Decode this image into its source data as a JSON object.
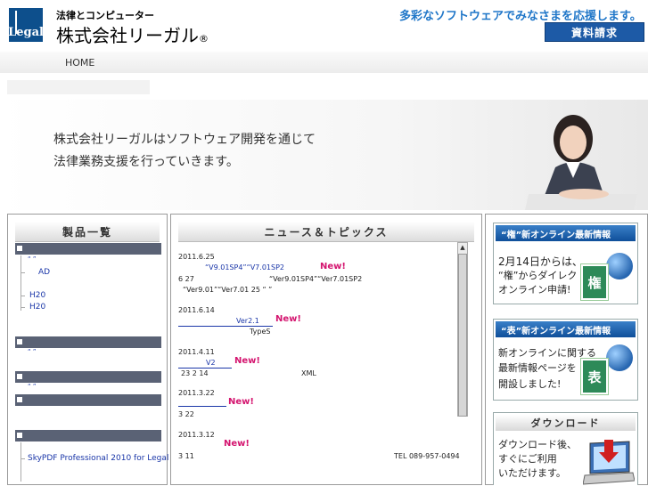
{
  "header": {
    "logo_text": "Legal",
    "tagline": "法律とコンピューター",
    "company": "株式会社リーガル",
    "company_mark": "®",
    "slogan": "多彩なソフトウェアでみなさまを応援します。",
    "request_button": "資料請求"
  },
  "nav": {
    "home": "HOME"
  },
  "hero": {
    "line1": "株式会社リーガルはソフトウェア開発を通じて",
    "line2": "法律業務支援を行っていきます。"
  },
  "products": {
    "heading": "製品一覧",
    "items": [
      "“ ”",
      "AD",
      "H20",
      "H20",
      "“ ”",
      "“ ”",
      "SkyPDF Professional 2010 for Legal"
    ]
  },
  "news": {
    "heading": "ニュース＆トピックス",
    "entries": [
      {
        "date": "2011.6.25",
        "line1": "“V9.01SP4”“V7.01SP2",
        "new": "New!",
        "line2": "6 27",
        "line2b": "“Ver9.01SP4”“Ver7.01SP2",
        "line3": "“Ver9.01”“Ver7.01    25  “ ”"
      },
      {
        "date": "2011.6.14",
        "line1": "Ver2.1",
        "new": "New!",
        "line2": "TypeS"
      },
      {
        "date": "2011.4.11",
        "line1": "V2",
        "new": "New!",
        "line2": "23 2 14",
        "line2b": "XML"
      },
      {
        "date": "2011.3.22",
        "new": "New!",
        "line2": "3 22"
      },
      {
        "date": "2011.3.12",
        "new": "New!",
        "line2": "3 11",
        "line2b": "TEL 089-957-0494"
      }
    ],
    "scroll_up": "▲"
  },
  "sidebar": {
    "banner1": {
      "head": "“権”新オンライン最新情報",
      "l1": "2月14日からは、",
      "l2": "“権”からダイレクト",
      "l3": "オンライン申請!",
      "kanji": "権"
    },
    "banner2": {
      "head": "“表”新オンライン最新情報",
      "l1": "新オンラインに関する",
      "l2": "最新情報ページを",
      "l3": "開設しました!",
      "kanji": "表"
    },
    "download": {
      "head": "ダウンロード",
      "l1": "ダウンロード後、",
      "l2": "すぐにご利用",
      "l3": "いただけます。"
    }
  },
  "colors": {
    "brand": "#0d4f8c",
    "accent": "#1f76c8",
    "new_tag": "#d4156f",
    "link": "#1a36a8"
  }
}
